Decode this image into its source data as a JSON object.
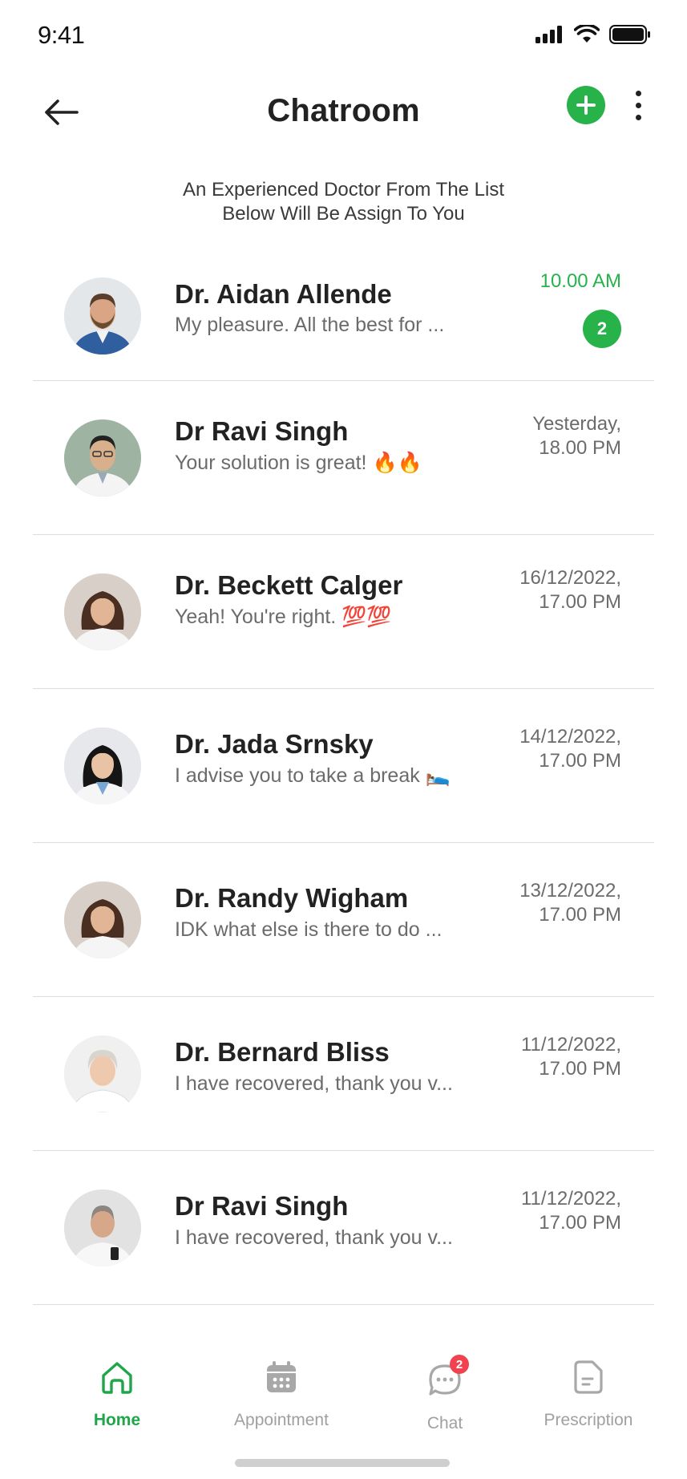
{
  "status": {
    "time": "9:41"
  },
  "header": {
    "title": "Chatroom"
  },
  "intro": {
    "text_line1": "An Experienced Doctor From The List",
    "text_line2": "Below Will Be Assign To You"
  },
  "chats": [
    {
      "name": "Dr. Aidan Allende",
      "message": "My pleasure. All the best for ...",
      "time_line1": "10.00 AM",
      "time_line2": "",
      "unread": "2",
      "avatar": "male-doctor-beard"
    },
    {
      "name": "Dr Ravi Singh",
      "message": "Your solution is great! 🔥🔥",
      "time_line1": "Yesterday,",
      "time_line2": "18.00 PM",
      "avatar": "male-doctor-glasses"
    },
    {
      "name": "Dr. Beckett Calger",
      "message": "Yeah! You're right. 💯💯",
      "time_line1": "16/12/2022,",
      "time_line2": "17.00 PM",
      "avatar": "female-doctor-brown-hair"
    },
    {
      "name": "Dr. Jada Srnsky",
      "message": "I advise you to take a break 🛌",
      "time_line1": "14/12/2022,",
      "time_line2": "17.00 PM",
      "avatar": "female-doctor-black-hair"
    },
    {
      "name": "Dr. Randy Wigham",
      "message": "IDK what else is there to do ...",
      "time_line1": "13/12/2022,",
      "time_line2": "17.00 PM",
      "avatar": "female-doctor-brown-hair"
    },
    {
      "name": "Dr. Bernard Bliss",
      "message": "I have recovered, thank you v...",
      "time_line1": "11/12/2022,",
      "time_line2": "17.00 PM",
      "avatar": "female-doctor-white-hair"
    },
    {
      "name": "Dr Ravi Singh",
      "message": "I have recovered, thank you v...",
      "time_line1": "11/12/2022,",
      "time_line2": "17.00 PM",
      "avatar": "male-doctor-phone"
    }
  ],
  "nav": {
    "home": "Home",
    "appointment": "Appointment",
    "chat": "Chat",
    "chat_badge": "2",
    "prescription": "Prescription"
  },
  "colors": {
    "accent": "#27b24a",
    "nav_active": "#1fa64a",
    "badge_red": "#f0424f",
    "divider": "#dcdcdc"
  }
}
